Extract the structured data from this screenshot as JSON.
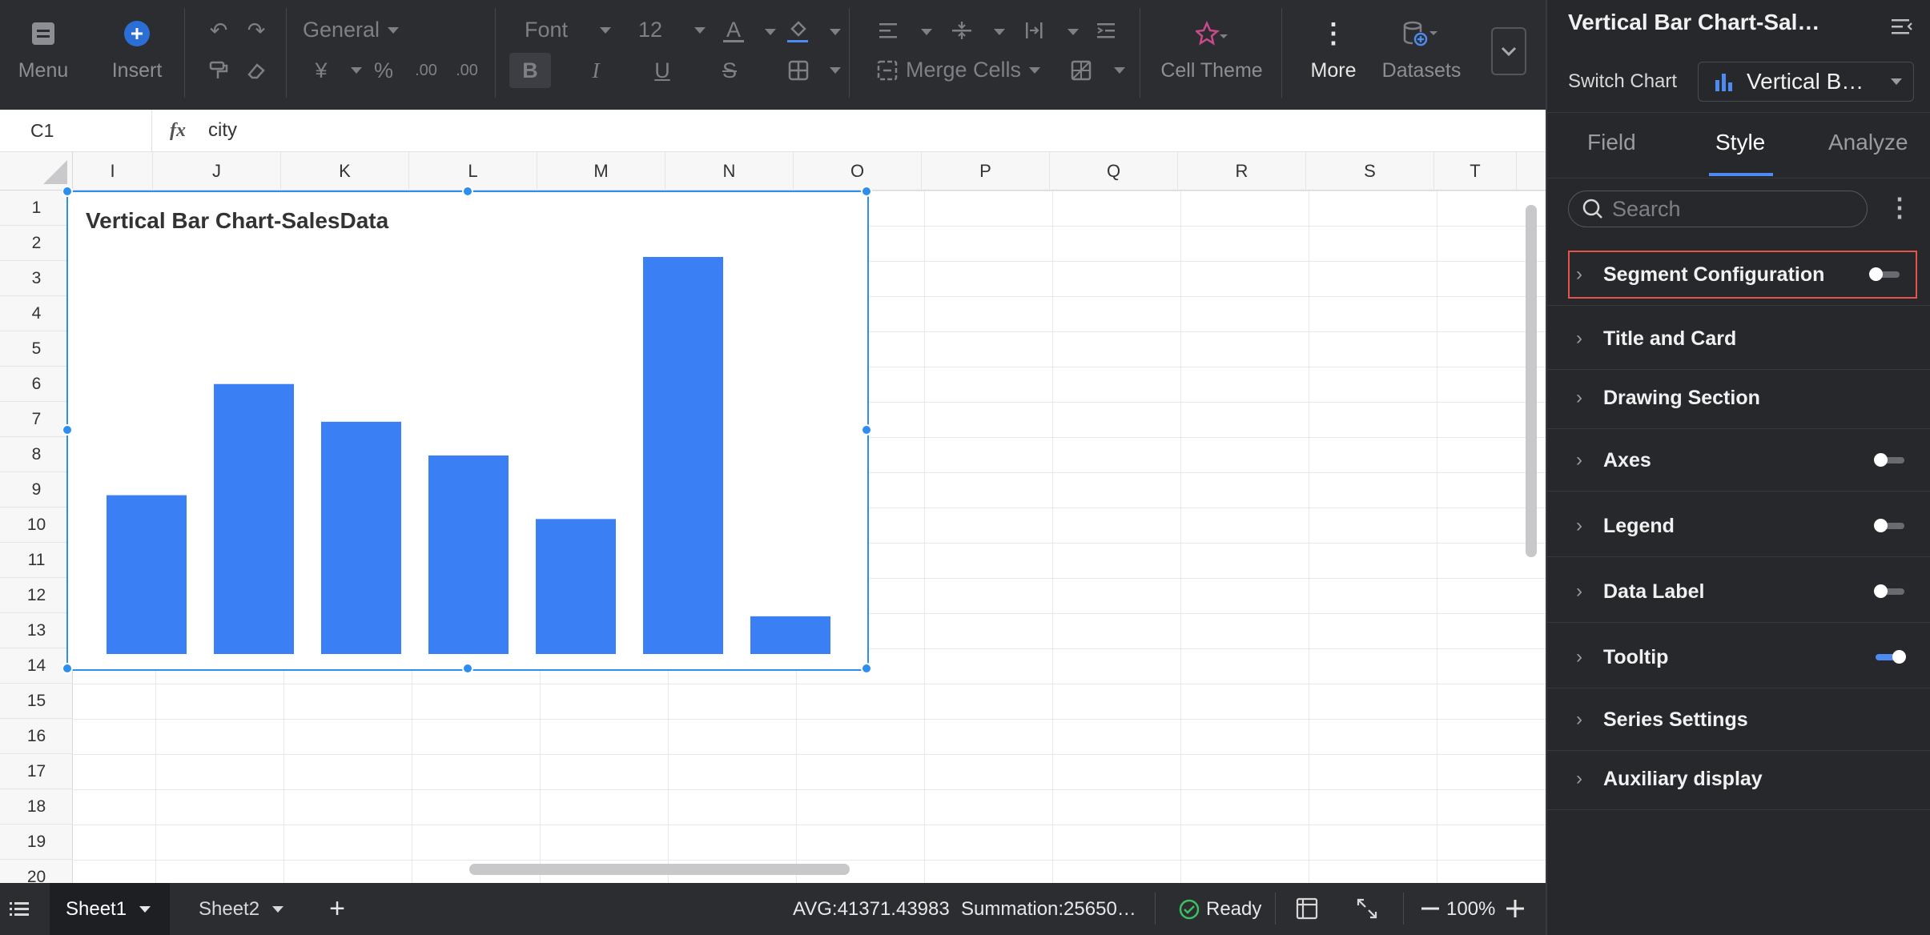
{
  "toolbar": {
    "menu_label": "Menu",
    "insert_label": "Insert",
    "number_format": "General",
    "font": "Font",
    "font_size": "12",
    "merge_cells": "Merge Cells",
    "cell_theme": "Cell Theme",
    "more": "More",
    "datasets": "Datasets"
  },
  "formula": {
    "cell_ref": "C1",
    "fx": "fx",
    "value": "city"
  },
  "columns": [
    "I",
    "J",
    "K",
    "L",
    "M",
    "N",
    "O",
    "P",
    "Q",
    "R",
    "S",
    "T"
  ],
  "rows": [
    "1",
    "2",
    "3",
    "4",
    "5",
    "6",
    "7",
    "8",
    "9",
    "10",
    "11",
    "12",
    "13",
    "14",
    "15",
    "16",
    "17",
    "18",
    "19",
    "20"
  ],
  "chart_data": {
    "type": "bar",
    "title": "Vertical Bar Chart-SalesData",
    "bar_color": "#3b7ff5",
    "values": [
      40,
      68,
      58.5,
      50,
      34,
      100,
      9.5
    ],
    "ylim": [
      0,
      100
    ]
  },
  "bottom": {
    "sheets": [
      "Sheet1",
      "Sheet2"
    ],
    "avg": "AVG:41371.43983",
    "summation": "Summation:25650…",
    "status": "Ready",
    "zoom": "100%"
  },
  "panel": {
    "title": "Vertical Bar Chart-Sal…",
    "switch_chart_label": "Switch Chart",
    "chart_type": "Vertical B…",
    "tabs": [
      "Field",
      "Style",
      "Analyze"
    ],
    "active_tab": "Style",
    "search_placeholder": "Search",
    "sections": [
      {
        "label": "Segment Configuration",
        "toggle": "off",
        "highlighted": true
      },
      {
        "label": "Title and Card"
      },
      {
        "label": "Drawing Section"
      },
      {
        "label": "Axes",
        "toggle": "off"
      },
      {
        "label": "Legend",
        "toggle": "off"
      },
      {
        "label": "Data Label",
        "toggle": "off"
      },
      {
        "label": "Tooltip",
        "toggle": "on"
      },
      {
        "label": "Series Settings"
      },
      {
        "label": "Auxiliary display"
      }
    ],
    "accent_color": "#4d8bf0",
    "highlight_color": "#e5534b"
  }
}
